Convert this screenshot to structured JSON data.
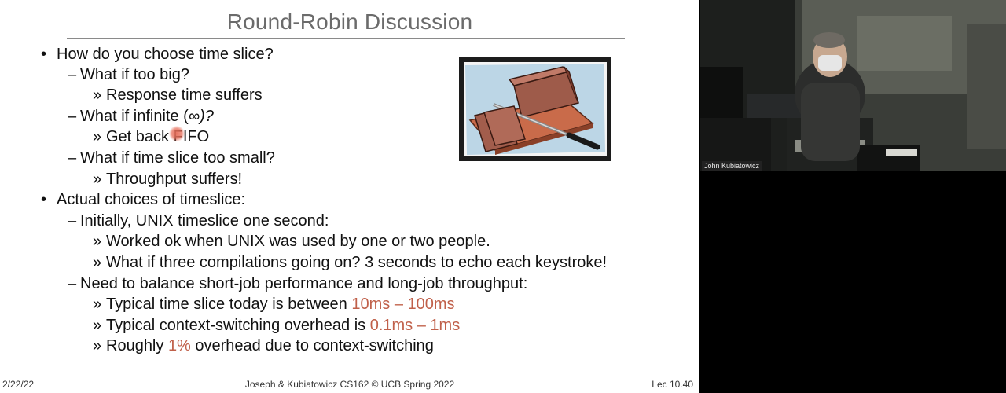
{
  "slide": {
    "title": "Round-Robin Discussion",
    "bullet_mark": "•",
    "dash_mark": "–",
    "sub_mark": "»",
    "lines": {
      "l1": "How do you choose time slice?",
      "l2": "What if too big?",
      "l3": "Response time suffers",
      "l4a": "What if infinite (",
      "l4b": "∞",
      "l4c": ")?",
      "l5": "Get back FIFO",
      "l6": "What if time slice too small?",
      "l7": "Throughput suffers!",
      "l8": "Actual choices of timeslice:",
      "l9": "Initially, UNIX timeslice one second:",
      "l10": "Worked ok when UNIX was used by one or two people.",
      "l11": "What if three compilations going on? 3 seconds to echo each keystroke!",
      "l12": "Need to balance short-job performance and long-job throughput:",
      "l13a": "Typical time slice today is between ",
      "l13b": "10ms – 100ms",
      "l14a": "Typical context-switching overhead is ",
      "l14b": "0.1ms – 1ms",
      "l15a": "Roughly ",
      "l15b": "1%",
      "l15c": " overhead due to context-switching"
    },
    "highlight_color": "#c0604a"
  },
  "footer": {
    "date": "2/22/22",
    "center": "Joseph & Kubiatowicz CS162 © UCB Spring 2022",
    "lecture": "Lec 10.40"
  },
  "video": {
    "speaker_name": "John Kubiatowicz"
  }
}
